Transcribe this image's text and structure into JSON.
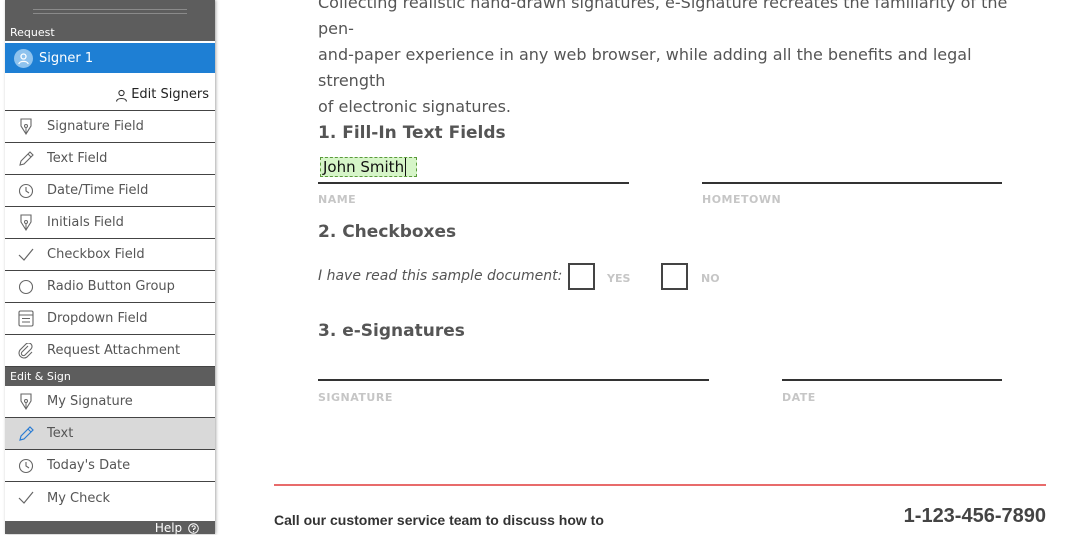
{
  "sidebar": {
    "request_header": "Request",
    "signer": {
      "label": "Signer 1",
      "color": "#1e7fd4"
    },
    "edit_signers_label": "Edit Signers",
    "request_items": [
      {
        "label": "Signature Field",
        "icon": "pen-nib-icon"
      },
      {
        "label": "Text Field",
        "icon": "pencil-icon"
      },
      {
        "label": "Date/Time Field",
        "icon": "clock-icon"
      },
      {
        "label": "Initials Field",
        "icon": "pen-nib-icon"
      },
      {
        "label": "Checkbox Field",
        "icon": "checkmark-icon"
      },
      {
        "label": "Radio Button Group",
        "icon": "radio-circle-icon"
      },
      {
        "label": "Dropdown Field",
        "icon": "dropdown-list-icon"
      },
      {
        "label": "Request Attachment",
        "icon": "paperclip-icon"
      }
    ],
    "edit_sign_header": "Edit & Sign",
    "edit_sign_items": [
      {
        "label": "My Signature",
        "icon": "pen-nib-icon"
      },
      {
        "label": "Text",
        "icon": "pencil-icon",
        "selected": true
      },
      {
        "label": "Today's Date",
        "icon": "clock-icon"
      },
      {
        "label": "My Check",
        "icon": "checkmark-icon"
      }
    ],
    "help_label": "Help"
  },
  "document": {
    "intro_lines": [
      "Collecting realistic hand-drawn signatures, e-Signature recreates the familiarity of the pen-",
      "and-paper experience in any web browser, while adding all the benefits and legal strength",
      "of electronic signatures."
    ],
    "section1_title": "1. Fill-In Text Fields",
    "name_value": "John Smith",
    "name_label": "NAME",
    "hometown_label": "HOMETOWN",
    "section2_title": "2. Checkboxes",
    "checkbox_sentence": "I have read this sample document:",
    "yes_label": "YES",
    "no_label": "NO",
    "section3_title": "3. e-Signatures",
    "signature_label": "SIGNATURE",
    "date_label": "DATE",
    "footer_cta": "Call our customer service team to discuss how to",
    "footer_phone": "1-123-456-7890",
    "accent_color": "#e86b6b"
  }
}
